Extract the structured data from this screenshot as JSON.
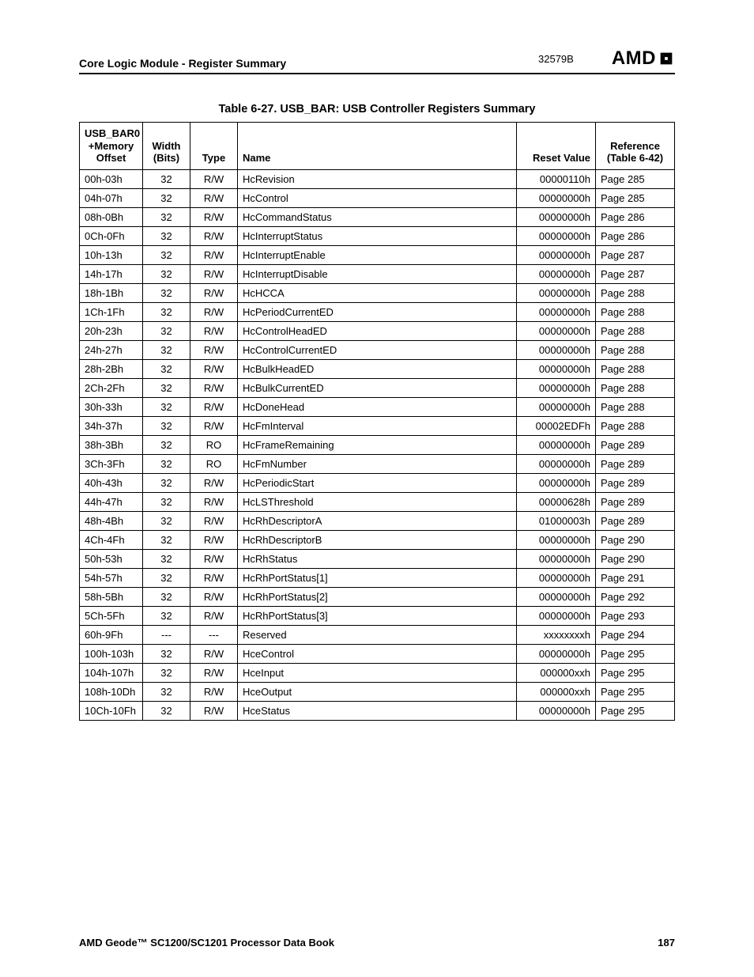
{
  "header": {
    "section_title": "Core Logic Module - Register Summary",
    "doc_number": "32579B",
    "logo_text": "AMD"
  },
  "table": {
    "caption": "Table 6-27.  USB_BAR: USB Controller Registers Summary",
    "columns": {
      "offset": "USB_BAR0\n+Memory\nOffset",
      "width": "Width\n(Bits)",
      "type": "Type",
      "name": "Name",
      "reset": "Reset Value",
      "reference": "Reference\n(Table 6-42)"
    },
    "rows": [
      {
        "offset": "00h-03h",
        "width": "32",
        "type": "R/W",
        "name": "HcRevision",
        "reset": "00000110h",
        "reference": "Page 285"
      },
      {
        "offset": "04h-07h",
        "width": "32",
        "type": "R/W",
        "name": "HcControl",
        "reset": "00000000h",
        "reference": "Page 285"
      },
      {
        "offset": "08h-0Bh",
        "width": "32",
        "type": "R/W",
        "name": "HcCommandStatus",
        "reset": "00000000h",
        "reference": "Page 286"
      },
      {
        "offset": "0Ch-0Fh",
        "width": "32",
        "type": "R/W",
        "name": "HcInterruptStatus",
        "reset": "00000000h",
        "reference": "Page 286"
      },
      {
        "offset": "10h-13h",
        "width": "32",
        "type": "R/W",
        "name": "HcInterruptEnable",
        "reset": "00000000h",
        "reference": "Page 287"
      },
      {
        "offset": "14h-17h",
        "width": "32",
        "type": "R/W",
        "name": "HcInterruptDisable",
        "reset": "00000000h",
        "reference": "Page 287"
      },
      {
        "offset": "18h-1Bh",
        "width": "32",
        "type": "R/W",
        "name": "HcHCCA",
        "reset": "00000000h",
        "reference": "Page 288"
      },
      {
        "offset": "1Ch-1Fh",
        "width": "32",
        "type": "R/W",
        "name": "HcPeriodCurrentED",
        "reset": "00000000h",
        "reference": "Page 288"
      },
      {
        "offset": "20h-23h",
        "width": "32",
        "type": "R/W",
        "name": "HcControlHeadED",
        "reset": "00000000h",
        "reference": "Page 288"
      },
      {
        "offset": "24h-27h",
        "width": "32",
        "type": "R/W",
        "name": "HcControlCurrentED",
        "reset": "00000000h",
        "reference": "Page 288"
      },
      {
        "offset": "28h-2Bh",
        "width": "32",
        "type": "R/W",
        "name": "HcBulkHeadED",
        "reset": "00000000h",
        "reference": "Page 288"
      },
      {
        "offset": "2Ch-2Fh",
        "width": "32",
        "type": "R/W",
        "name": "HcBulkCurrentED",
        "reset": "00000000h",
        "reference": "Page 288"
      },
      {
        "offset": "30h-33h",
        "width": "32",
        "type": "R/W",
        "name": "HcDoneHead",
        "reset": "00000000h",
        "reference": "Page 288"
      },
      {
        "offset": "34h-37h",
        "width": "32",
        "type": "R/W",
        "name": "HcFmInterval",
        "reset": "00002EDFh",
        "reference": "Page 288"
      },
      {
        "offset": "38h-3Bh",
        "width": "32",
        "type": "RO",
        "name": "HcFrameRemaining",
        "reset": "00000000h",
        "reference": "Page 289"
      },
      {
        "offset": "3Ch-3Fh",
        "width": "32",
        "type": "RO",
        "name": "HcFmNumber",
        "reset": "00000000h",
        "reference": "Page 289"
      },
      {
        "offset": "40h-43h",
        "width": "32",
        "type": "R/W",
        "name": "HcPeriodicStart",
        "reset": "00000000h",
        "reference": "Page 289"
      },
      {
        "offset": "44h-47h",
        "width": "32",
        "type": "R/W",
        "name": "HcLSThreshold",
        "reset": "00000628h",
        "reference": "Page 289"
      },
      {
        "offset": "48h-4Bh",
        "width": "32",
        "type": "R/W",
        "name": "HcRhDescriptorA",
        "reset": "01000003h",
        "reference": "Page 289"
      },
      {
        "offset": "4Ch-4Fh",
        "width": "32",
        "type": "R/W",
        "name": "HcRhDescriptorB",
        "reset": "00000000h",
        "reference": "Page 290"
      },
      {
        "offset": "50h-53h",
        "width": "32",
        "type": "R/W",
        "name": "HcRhStatus",
        "reset": "00000000h",
        "reference": "Page 290"
      },
      {
        "offset": "54h-57h",
        "width": "32",
        "type": "R/W",
        "name": "HcRhPortStatus[1]",
        "reset": "00000000h",
        "reference": "Page 291"
      },
      {
        "offset": "58h-5Bh",
        "width": "32",
        "type": "R/W",
        "name": "HcRhPortStatus[2]",
        "reset": "00000000h",
        "reference": "Page 292"
      },
      {
        "offset": "5Ch-5Fh",
        "width": "32",
        "type": "R/W",
        "name": "HcRhPortStatus[3]",
        "reset": "00000000h",
        "reference": "Page 293"
      },
      {
        "offset": "60h-9Fh",
        "width": "---",
        "type": "---",
        "name": "Reserved",
        "reset": "xxxxxxxxh",
        "reference": "Page 294"
      },
      {
        "offset": "100h-103h",
        "width": "32",
        "type": "R/W",
        "name": "HceControl",
        "reset": "00000000h",
        "reference": "Page 295"
      },
      {
        "offset": "104h-107h",
        "width": "32",
        "type": "R/W",
        "name": "HceInput",
        "reset": "000000xxh",
        "reference": "Page 295"
      },
      {
        "offset": "108h-10Dh",
        "width": "32",
        "type": "R/W",
        "name": "HceOutput",
        "reset": "000000xxh",
        "reference": "Page 295"
      },
      {
        "offset": "10Ch-10Fh",
        "width": "32",
        "type": "R/W",
        "name": "HceStatus",
        "reset": "00000000h",
        "reference": "Page 295"
      }
    ]
  },
  "footer": {
    "book_title": "AMD Geode™ SC1200/SC1201 Processor Data Book",
    "page_number": "187"
  }
}
